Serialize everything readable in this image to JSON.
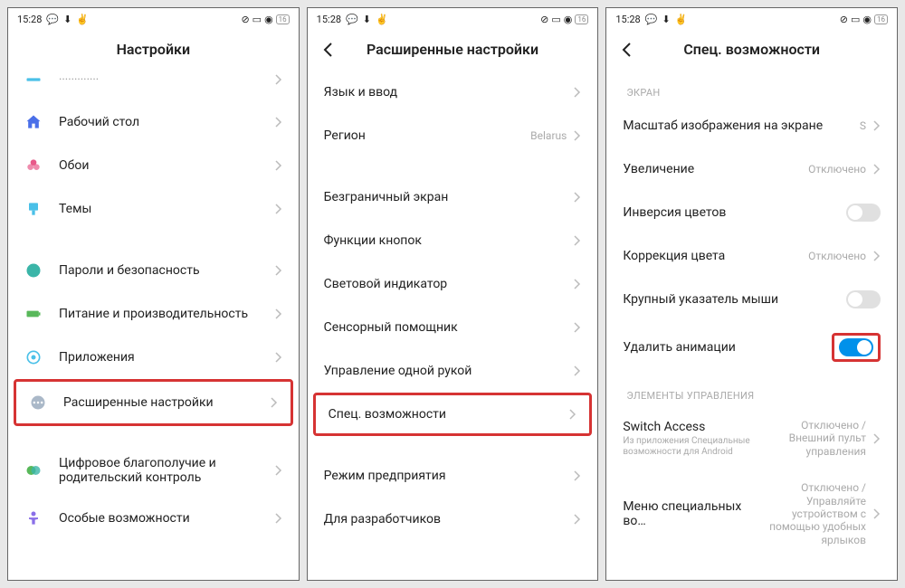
{
  "status": {
    "time": "15:28",
    "battery": "16"
  },
  "screen1": {
    "title": "Настройки",
    "items": [
      {
        "label": "Рабочий стол"
      },
      {
        "label": "Обои"
      },
      {
        "label": "Темы"
      },
      {
        "label": "Пароли и безопасность"
      },
      {
        "label": "Питание и производительность"
      },
      {
        "label": "Приложения"
      },
      {
        "label": "Расширенные настройки"
      },
      {
        "label": "Цифровое благополучие и родительский контроль"
      },
      {
        "label": "Особые возможности"
      }
    ]
  },
  "screen2": {
    "title": "Расширенные настройки",
    "items": [
      {
        "label": "Язык и ввод"
      },
      {
        "label": "Регион",
        "value": "Belarus"
      },
      {
        "label": "Безграничный экран"
      },
      {
        "label": "Функции кнопок"
      },
      {
        "label": "Световой индикатор"
      },
      {
        "label": "Сенсорный помощник"
      },
      {
        "label": "Управление одной рукой"
      },
      {
        "label": "Спец. возможности"
      },
      {
        "label": "Режим предприятия"
      },
      {
        "label": "Для разработчиков"
      }
    ]
  },
  "screen3": {
    "title": "Спец. возможности",
    "sections": {
      "screen": "ЭКРАН",
      "controls": "ЭЛЕМЕНТЫ УПРАВЛЕНИЯ"
    },
    "items": [
      {
        "label": "Масштаб изображения на экране",
        "value": "S"
      },
      {
        "label": "Увеличение",
        "value": "Отключено"
      },
      {
        "label": "Инверсия цветов"
      },
      {
        "label": "Коррекция цвета",
        "value": "Отключено"
      },
      {
        "label": "Крупный указатель мыши"
      },
      {
        "label": "Удалить анимации"
      },
      {
        "label": "Switch Access",
        "sublabel": "Из приложения Специальные возможности для Android",
        "value": "Отключено / Внешний пульт управления"
      },
      {
        "label": "Меню специальных во…",
        "value": "Отключено / Управляйте устройством с помощью удобных ярлыков"
      }
    ]
  }
}
